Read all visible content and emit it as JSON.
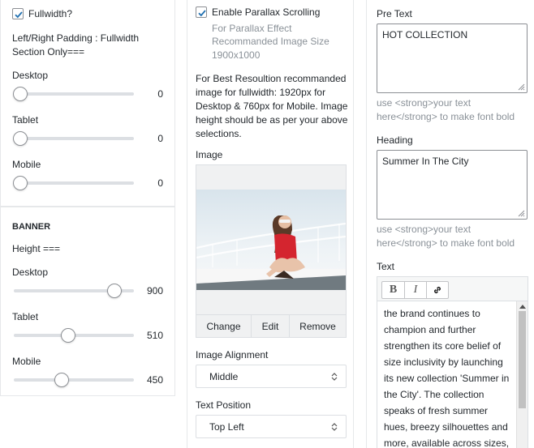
{
  "col1": {
    "fullwidth_label": "Fullwidth?",
    "fullwidth_checked": true,
    "padding_title": "Left/Right Padding : Fullwidth Section Only===",
    "padding_sliders": [
      {
        "label": "Desktop",
        "value": "0"
      },
      {
        "label": "Tablet",
        "value": "0"
      },
      {
        "label": "Mobile",
        "value": "0"
      }
    ],
    "banner_title": "BANNER",
    "height_title": "Height ===",
    "height_sliders": [
      {
        "label": "Desktop",
        "value": "900"
      },
      {
        "label": "Tablet",
        "value": "510"
      },
      {
        "label": "Mobile",
        "value": "450"
      }
    ]
  },
  "col2": {
    "parallax_label": "Enable Parallax Scrolling",
    "parallax_checked": true,
    "parallax_hint_1": "For Parallax Effect",
    "parallax_hint_2": "Recommanded Image Size",
    "parallax_hint_3": "1900x1000",
    "resolution_line_1": "For Best Resoultion recommanded",
    "resolution_line_2": "image for fullwidth: 1920px for",
    "resolution_line_3": "Desktop & 760px for Mobile. Image",
    "resolution_line_4": "height should be as per your above",
    "resolution_line_5": "selections.",
    "image_label": "Image",
    "image_buttons": {
      "change": "Change",
      "edit": "Edit",
      "remove": "Remove"
    },
    "alignment_label": "Image Alignment",
    "alignment_value": "Middle",
    "text_position_label": "Text Position",
    "text_position_value": "Top Left"
  },
  "col3": {
    "pre_text_label": "Pre Text",
    "pre_text_value": "HOT COLLECTION",
    "pre_text_hint_1": "use <strong>your text",
    "pre_text_hint_2": "here</strong> to make font bold",
    "heading_label": "Heading",
    "heading_value": "Summer In The City",
    "heading_hint_1": "use <strong>your text",
    "heading_hint_2": "here</strong> to make font bold",
    "text_label": "Text",
    "toolbar": {
      "bold": "B",
      "italic": "I"
    },
    "text_lines": [
      "the brand continues to",
      "champion and further",
      "strengthen its core belief of",
      "size inclusivity by launching",
      "its new collection 'Summer in",
      "the City'. The collection",
      "speaks of fresh summer",
      "hues, breezy silhouettes and",
      "more, available across sizes,"
    ]
  },
  "colors": {
    "accent": "#2271b1",
    "muted": "#8a9198",
    "border": "#dcdfe3"
  }
}
